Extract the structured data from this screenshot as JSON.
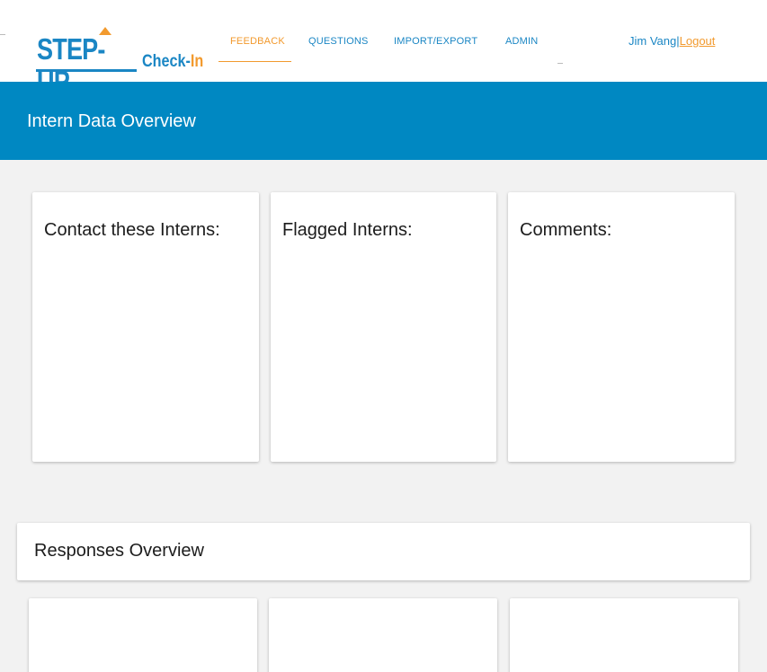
{
  "brand": {
    "logo_text": "STEP-UP",
    "product_prefix": "Check-",
    "product_suffix": "In",
    "colors": {
      "primary": "#1a86c4",
      "accent": "#f29a2e"
    }
  },
  "nav": {
    "items": [
      {
        "label": "FEEDBACK",
        "active": true
      },
      {
        "label": "QUESTIONS",
        "active": false
      },
      {
        "label": "IMPORT/EXPORT",
        "active": false
      },
      {
        "label": "ADMIN",
        "active": false
      }
    ]
  },
  "user": {
    "name": "Jim Vang",
    "separator": "|",
    "logout_label": "Logout"
  },
  "header": {
    "title": "Intern Data Overview",
    "band_color": "#0088c2"
  },
  "cards": [
    {
      "title": "Contact these Interns:"
    },
    {
      "title": "Flagged Interns:"
    },
    {
      "title": "Comments:"
    }
  ],
  "responses": {
    "title": "Responses Overview"
  }
}
